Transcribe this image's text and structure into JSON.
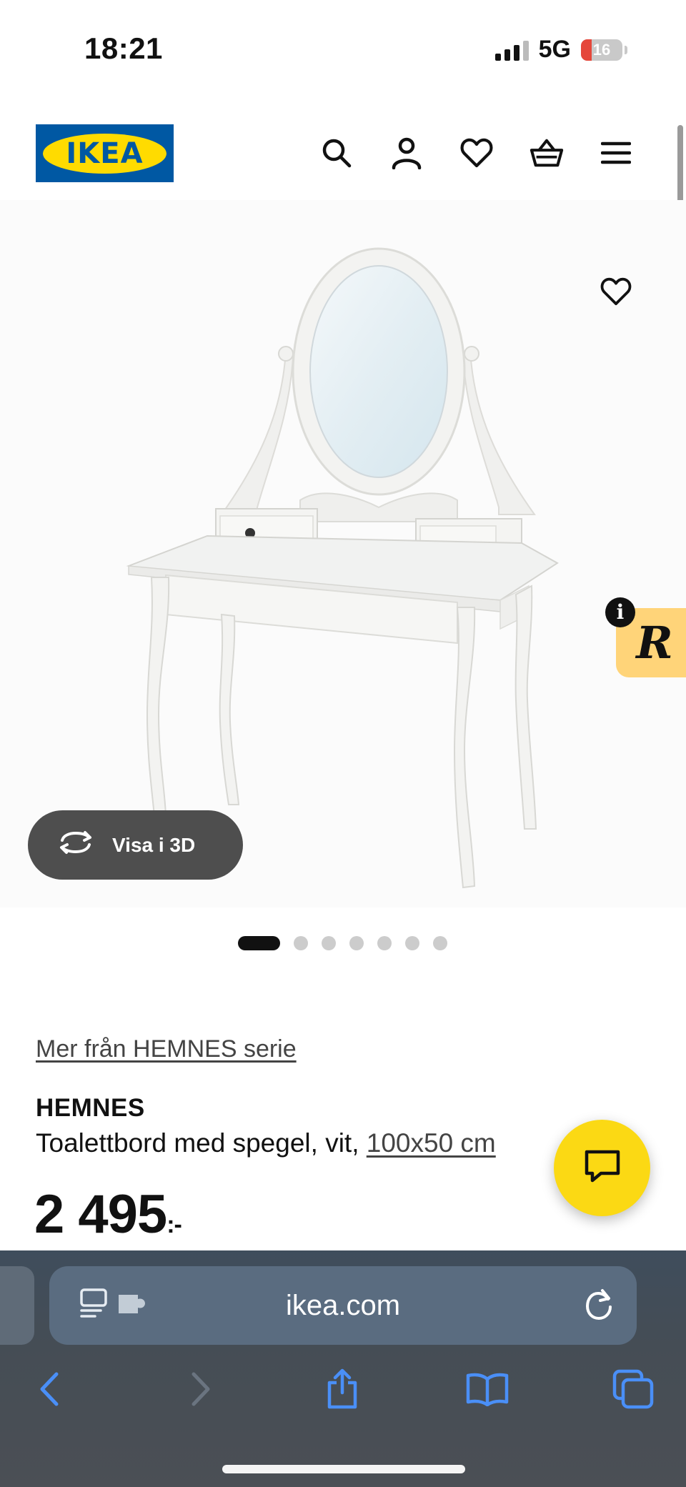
{
  "status_bar": {
    "time": "18:21",
    "network": "5G",
    "battery_level": "16",
    "battery_fraction": 0.16
  },
  "header": {
    "logo_text": "IKEA",
    "icons": [
      "search-icon",
      "account-icon",
      "heart-icon",
      "basket-icon",
      "menu-icon"
    ]
  },
  "gallery": {
    "view_3d_label": "Visa i 3D",
    "image_count": 7,
    "active_index": 0
  },
  "badge": {
    "info_label": "i",
    "letter": "R"
  },
  "product": {
    "series_link": "Mer från HEMNES serie",
    "name": "HEMNES",
    "description": "Toalettbord med spegel, vit, ",
    "size": "100x50 cm",
    "price": "2 495",
    "price_suffix": ":-"
  },
  "browser": {
    "url": "ikea.com"
  },
  "colors": {
    "ikea_blue": "#0058a3",
    "ikea_yellow": "#ffdb00",
    "chat_yellow": "#fbd914",
    "safari_blue": "#4a8ff7"
  }
}
